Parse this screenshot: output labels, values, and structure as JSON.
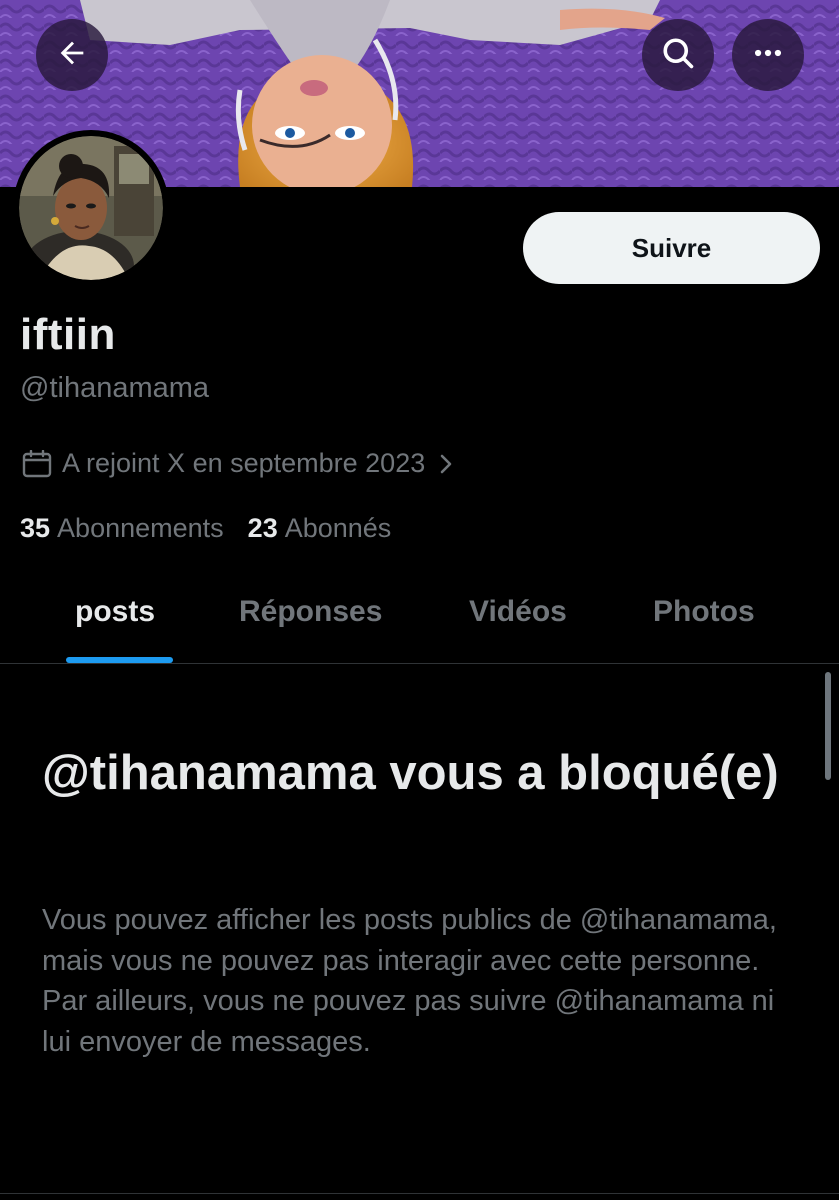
{
  "header": {
    "back_icon": "arrow-left-icon",
    "search_icon": "search-icon",
    "more_icon": "more-horizontal-icon"
  },
  "profile": {
    "display_name": "iftiin",
    "handle": "@tihanamama",
    "joined": "A rejoint X en septembre 2023",
    "follow_label": "Suivre",
    "following_count": "35",
    "following_label": "Abonnements",
    "followers_count": "23",
    "followers_label": "Abonnés"
  },
  "tabs": [
    {
      "label": "posts",
      "active": true
    },
    {
      "label": "Réponses",
      "active": false
    },
    {
      "label": "Vidéos",
      "active": false
    },
    {
      "label": "Photos",
      "active": false
    }
  ],
  "blocked": {
    "title": "@tihanamama vous a bloqué(e)",
    "body": "Vous pouvez afficher les posts publics de @tihanamama, mais vous ne pouvez pas interagir avec cette personne. Par ailleurs, vous ne pouvez pas suivre @tihanamama ni lui envoyer de messages."
  },
  "colors": {
    "background": "#000000",
    "accent": "#1d9bf0",
    "primary_text": "#e7e9ea",
    "secondary_text": "#71767b",
    "follow_button": "#eff3f4"
  }
}
